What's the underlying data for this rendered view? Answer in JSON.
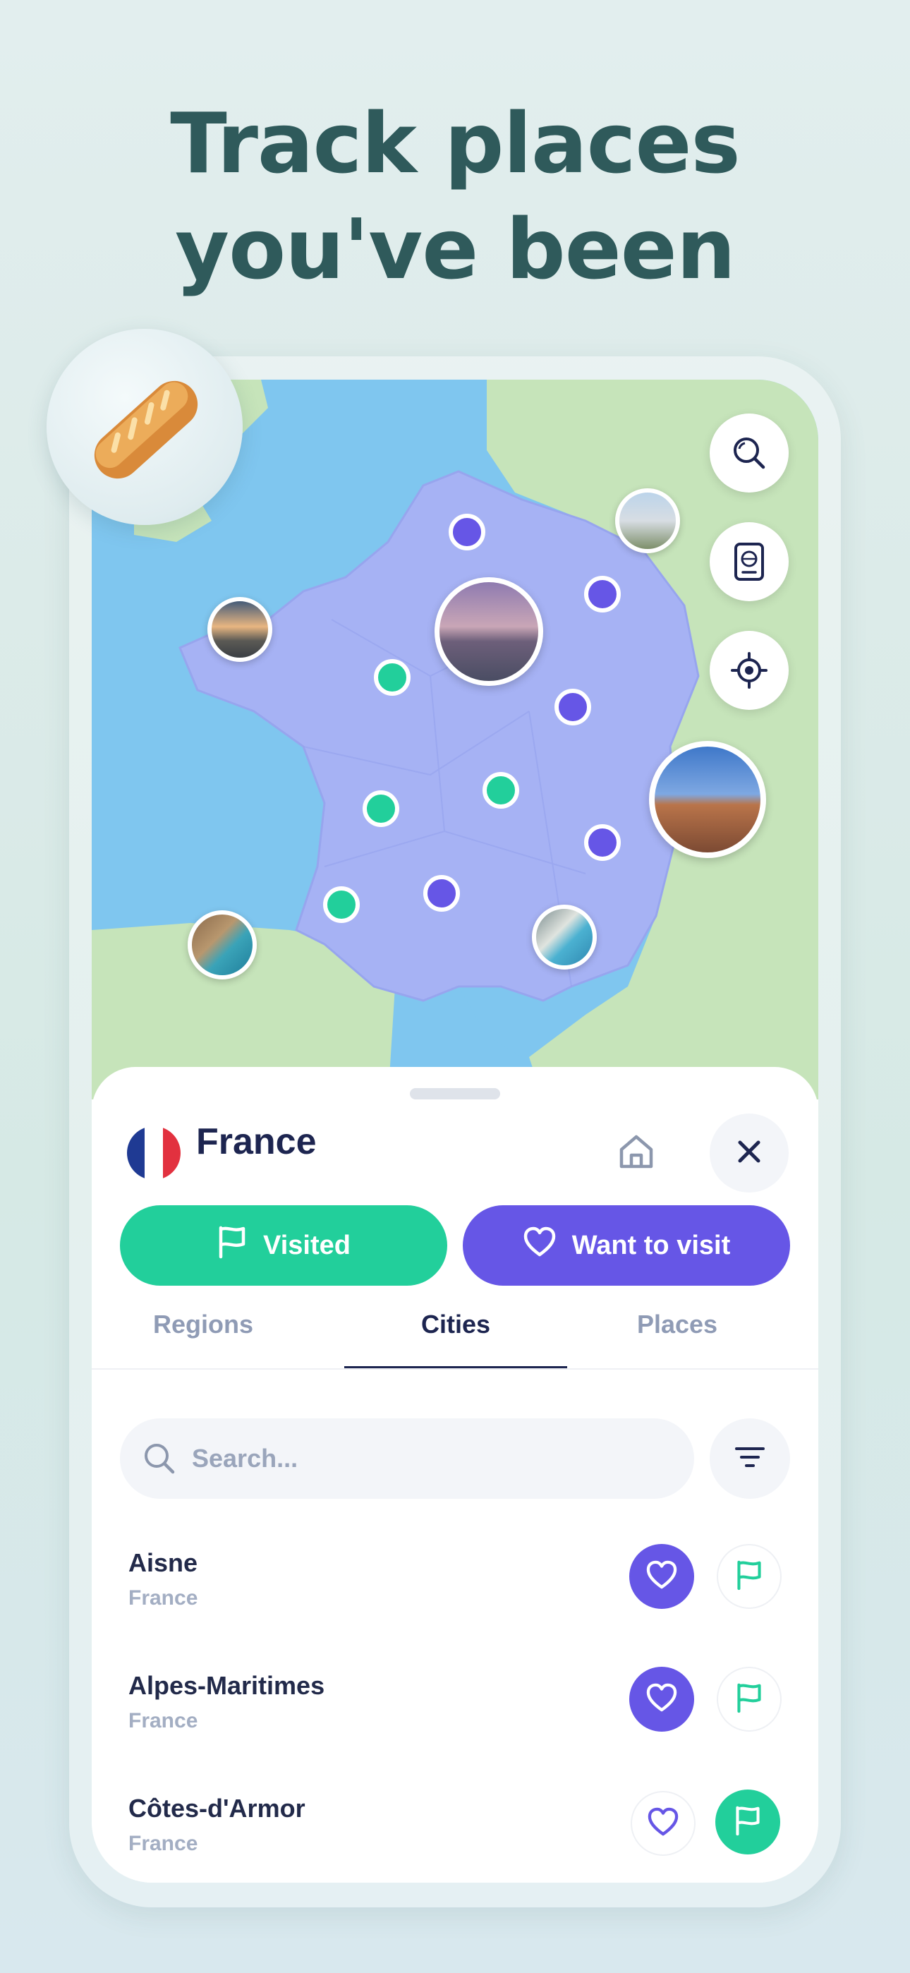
{
  "headline": {
    "line1": "Track places",
    "line2": "you've been"
  },
  "map": {
    "colors": {
      "sea": "#79c3ef",
      "land": "#c2e2b6",
      "france": "#a6b2f4",
      "visited": "#22cf9b",
      "want": "#6656e6"
    },
    "controls": [
      {
        "icon": "search-icon"
      },
      {
        "icon": "passport-icon"
      },
      {
        "icon": "locate-icon"
      }
    ],
    "photo_pins": [
      "eiffel-tower",
      "colosseum",
      "castle",
      "coast-sunset",
      "cliff-bay",
      "nice-beach"
    ]
  },
  "sheet": {
    "country": "France",
    "flag": "france-flag",
    "home_icon": "home-icon",
    "close_icon": "close-icon",
    "visited_label": "Visited",
    "want_label": "Want to visit",
    "tabs": [
      {
        "label": "Regions",
        "active": false
      },
      {
        "label": "Cities",
        "active": true
      },
      {
        "label": "Places",
        "active": false
      }
    ],
    "search_placeholder": "Search...",
    "items": [
      {
        "name": "Aisne",
        "country": "France",
        "want": true,
        "visited": false
      },
      {
        "name": "Alpes-Maritimes",
        "country": "France",
        "want": true,
        "visited": false
      },
      {
        "name": "Côtes-d'Armor",
        "country": "France",
        "want": false,
        "visited": true
      }
    ]
  }
}
